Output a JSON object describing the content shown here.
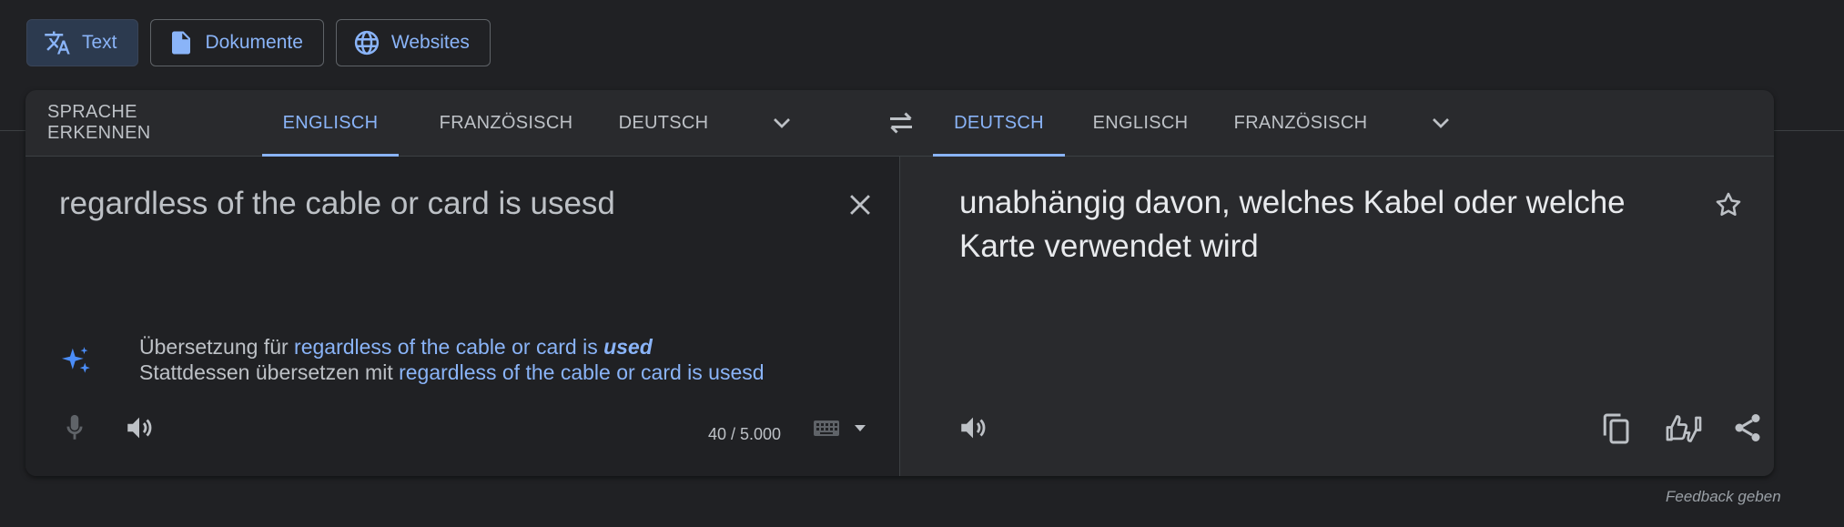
{
  "modes": [
    {
      "label": "Text",
      "icon": "translate-icon",
      "active": true
    },
    {
      "label": "Dokumente",
      "icon": "document-icon",
      "active": false
    },
    {
      "label": "Websites",
      "icon": "globe-icon",
      "active": false
    }
  ],
  "source_langs": [
    {
      "label": "SPRACHE ERKENNEN",
      "active": false
    },
    {
      "label": "ENGLISCH",
      "active": true
    },
    {
      "label": "FRANZÖSISCH",
      "active": false
    },
    {
      "label": "DEUTSCH",
      "active": false
    }
  ],
  "target_langs": [
    {
      "label": "DEUTSCH",
      "active": true
    },
    {
      "label": "ENGLISCH",
      "active": false
    },
    {
      "label": "FRANZÖSISCH",
      "active": false
    }
  ],
  "source": {
    "text": "regardless of the cable or card is usesd",
    "char_count": "40 / 5.000"
  },
  "suggestion": {
    "line1_prefix": "Übersetzung für ",
    "line1_link": "regardless of the cable or card is ",
    "line1_emph": "used",
    "line2_prefix": "Stattdessen übersetzen mit ",
    "line2_link": "regardless of the cable or card is usesd"
  },
  "target": {
    "text": "unabhängig davon, welches Kabel oder welche Karte verwendet wird"
  },
  "feedback_label": "Feedback geben",
  "colors": {
    "accent": "#8ab4f8",
    "background": "#202124",
    "card": "#292a2d",
    "text": "#e8eaed",
    "muted": "#bdc1c6"
  }
}
